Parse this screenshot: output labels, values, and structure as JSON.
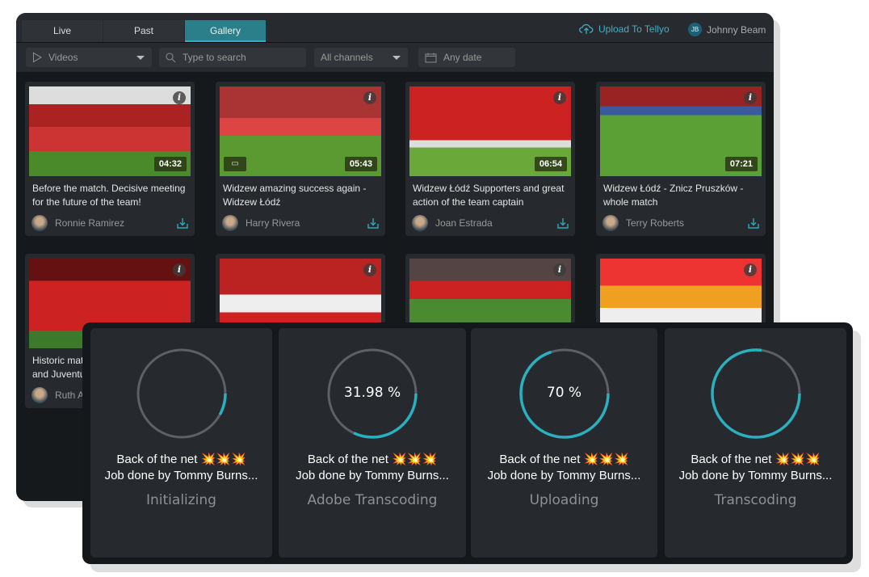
{
  "tabs": [
    {
      "label": "Live"
    },
    {
      "label": "Past"
    },
    {
      "label": "Gallery",
      "active": true
    }
  ],
  "header": {
    "upload_label": "Upload To Tellyo",
    "user_initials": "JB",
    "user_name": "Johnny Beam"
  },
  "filters": {
    "type_value": "Videos",
    "search_placeholder": "Type to search",
    "channel_value": "All channels",
    "date_value": "Any date"
  },
  "colors": {
    "accent": "#2bb0c0",
    "active_tab": "#2a7f8a",
    "panel": "#26292d",
    "background": "#16191c"
  },
  "videos": [
    {
      "title": "Before the match. Decisive meeting for the future of the team!",
      "duration": "04:32",
      "author": "Ronnie Ramirez"
    },
    {
      "title": "Widzew amazing success again - Widzew Łódź",
      "duration": "05:43",
      "author": "Harry Rivera",
      "live_icon": true
    },
    {
      "title": "Widzew Łódź Supporters and great action of the team captain",
      "duration": "06:54",
      "author": "Joan Estrada"
    },
    {
      "title": "Widzew Łódź - Znicz Pruszków - whole match",
      "duration": "07:21",
      "author": "Terry Roberts"
    },
    {
      "title": "Historic mat",
      "title2": "and Juventu",
      "author": "Ruth A"
    },
    {
      "title": "",
      "author": ""
    },
    {
      "title": "",
      "author": ""
    },
    {
      "title": "",
      "author": ""
    }
  ],
  "jobs": [
    {
      "title": "Back of the net 💥💥💥",
      "subtitle": "Job done by Tommy Burns...",
      "status": "Initializing",
      "progress": 0.08,
      "percent_label": ""
    },
    {
      "title": "Back of the net 💥💥💥",
      "subtitle": "Job done by Tommy Burns...",
      "status": "Adobe Transcoding",
      "progress": 0.3198,
      "percent_label": "31.98 %"
    },
    {
      "title": "Back of the net 💥💥💥",
      "subtitle": "Job done by Tommy Burns...",
      "status": "Uploading",
      "progress": 0.7,
      "percent_label": "70 %"
    },
    {
      "title": "Back of the net 💥💥💥",
      "subtitle": "Job done by Tommy Burns...",
      "status": "Transcoding",
      "progress": 0.77,
      "percent_label": ""
    }
  ]
}
